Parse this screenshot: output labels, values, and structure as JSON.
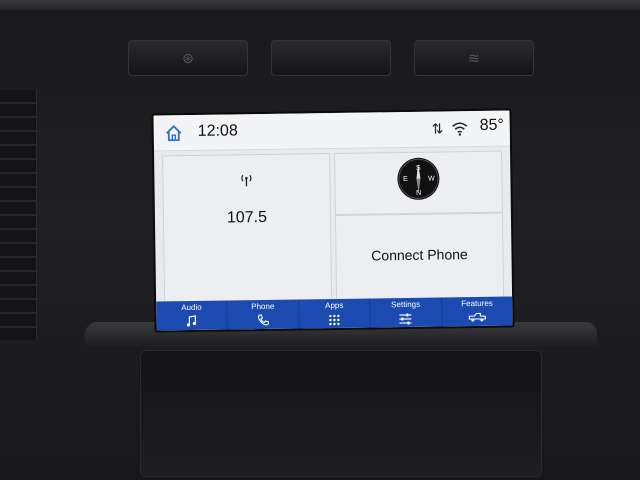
{
  "status": {
    "time": "12:08",
    "temperature": "85°",
    "icons": [
      "home-icon",
      "sort-arrows-icon",
      "wifi-icon"
    ]
  },
  "radio": {
    "frequency": "107.5",
    "icon": "antenna-icon"
  },
  "compass": {
    "letters": [
      "S",
      "W",
      "N",
      "E"
    ],
    "icon": "compass-icon"
  },
  "phone": {
    "label": "Connect Phone"
  },
  "nav": {
    "items": [
      {
        "label": "Audio",
        "icon": "music-note-icon"
      },
      {
        "label": "Phone",
        "icon": "phone-icon"
      },
      {
        "label": "Apps",
        "icon": "apps-grid-icon"
      },
      {
        "label": "Settings",
        "icon": "sliders-icon"
      },
      {
        "label": "Features",
        "icon": "truck-icon"
      }
    ]
  },
  "colors": {
    "nav_background": "#1b4bb1",
    "screen_background": "#e9eaee",
    "home_icon": "#2a6fd1"
  }
}
